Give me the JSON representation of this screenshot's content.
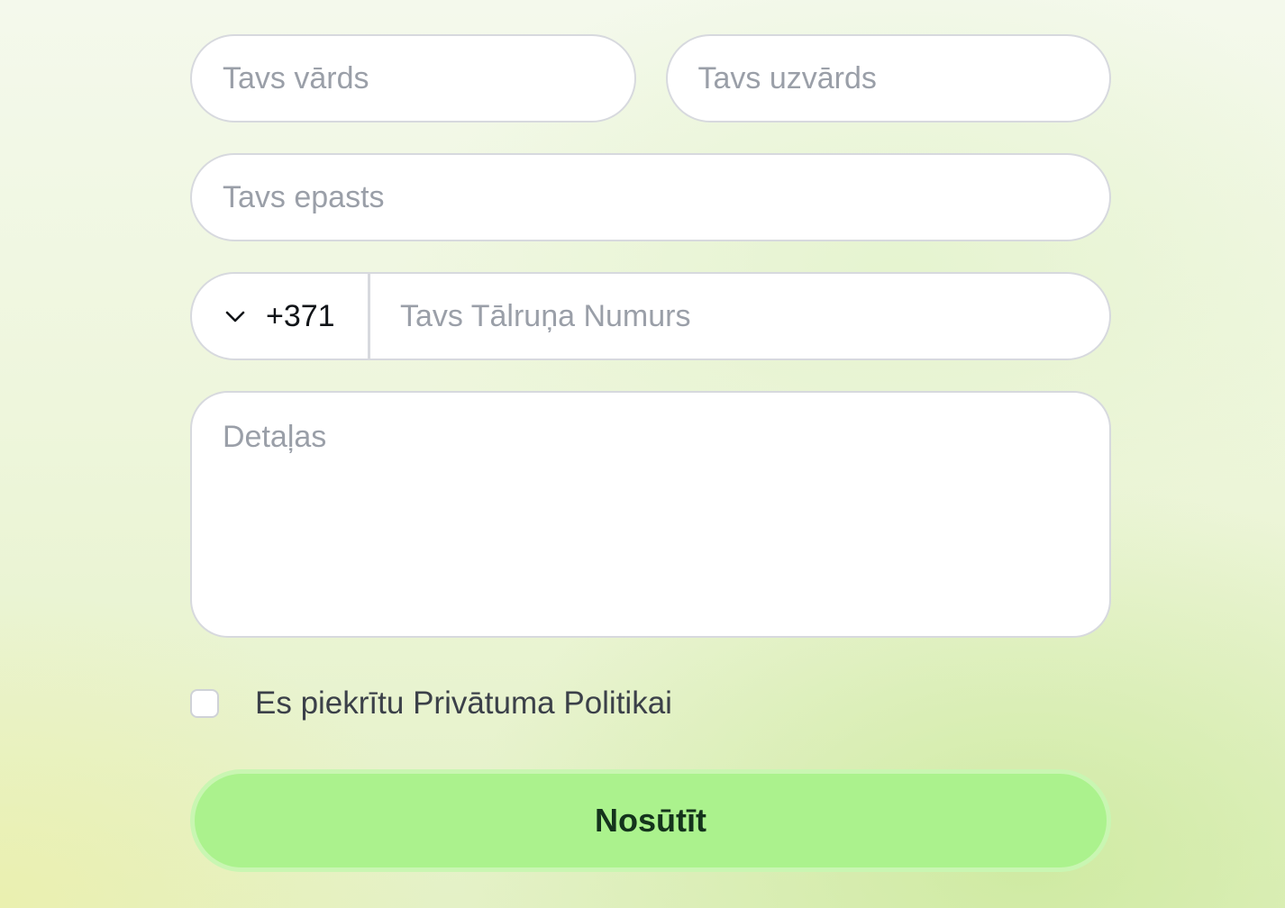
{
  "form": {
    "first_name": {
      "placeholder": "Tavs vārds",
      "value": ""
    },
    "last_name": {
      "placeholder": "Tavs uzvārds",
      "value": ""
    },
    "email": {
      "placeholder": "Tavs epasts",
      "value": ""
    },
    "phone": {
      "country_code": "+371",
      "country_icon": "chevron-down-icon",
      "placeholder": "Tavs Tālruņa Numurs",
      "value": ""
    },
    "details": {
      "placeholder": "Detaļas",
      "value": ""
    },
    "consent": {
      "label": "Es piekrītu Privātuma Politikai",
      "checked": false
    },
    "submit_label": "Nosūtīt"
  },
  "colors": {
    "submit_bg": "#abf28d",
    "submit_text": "#14331c",
    "placeholder": "#9a9fa8",
    "border": "#d7d9de"
  }
}
